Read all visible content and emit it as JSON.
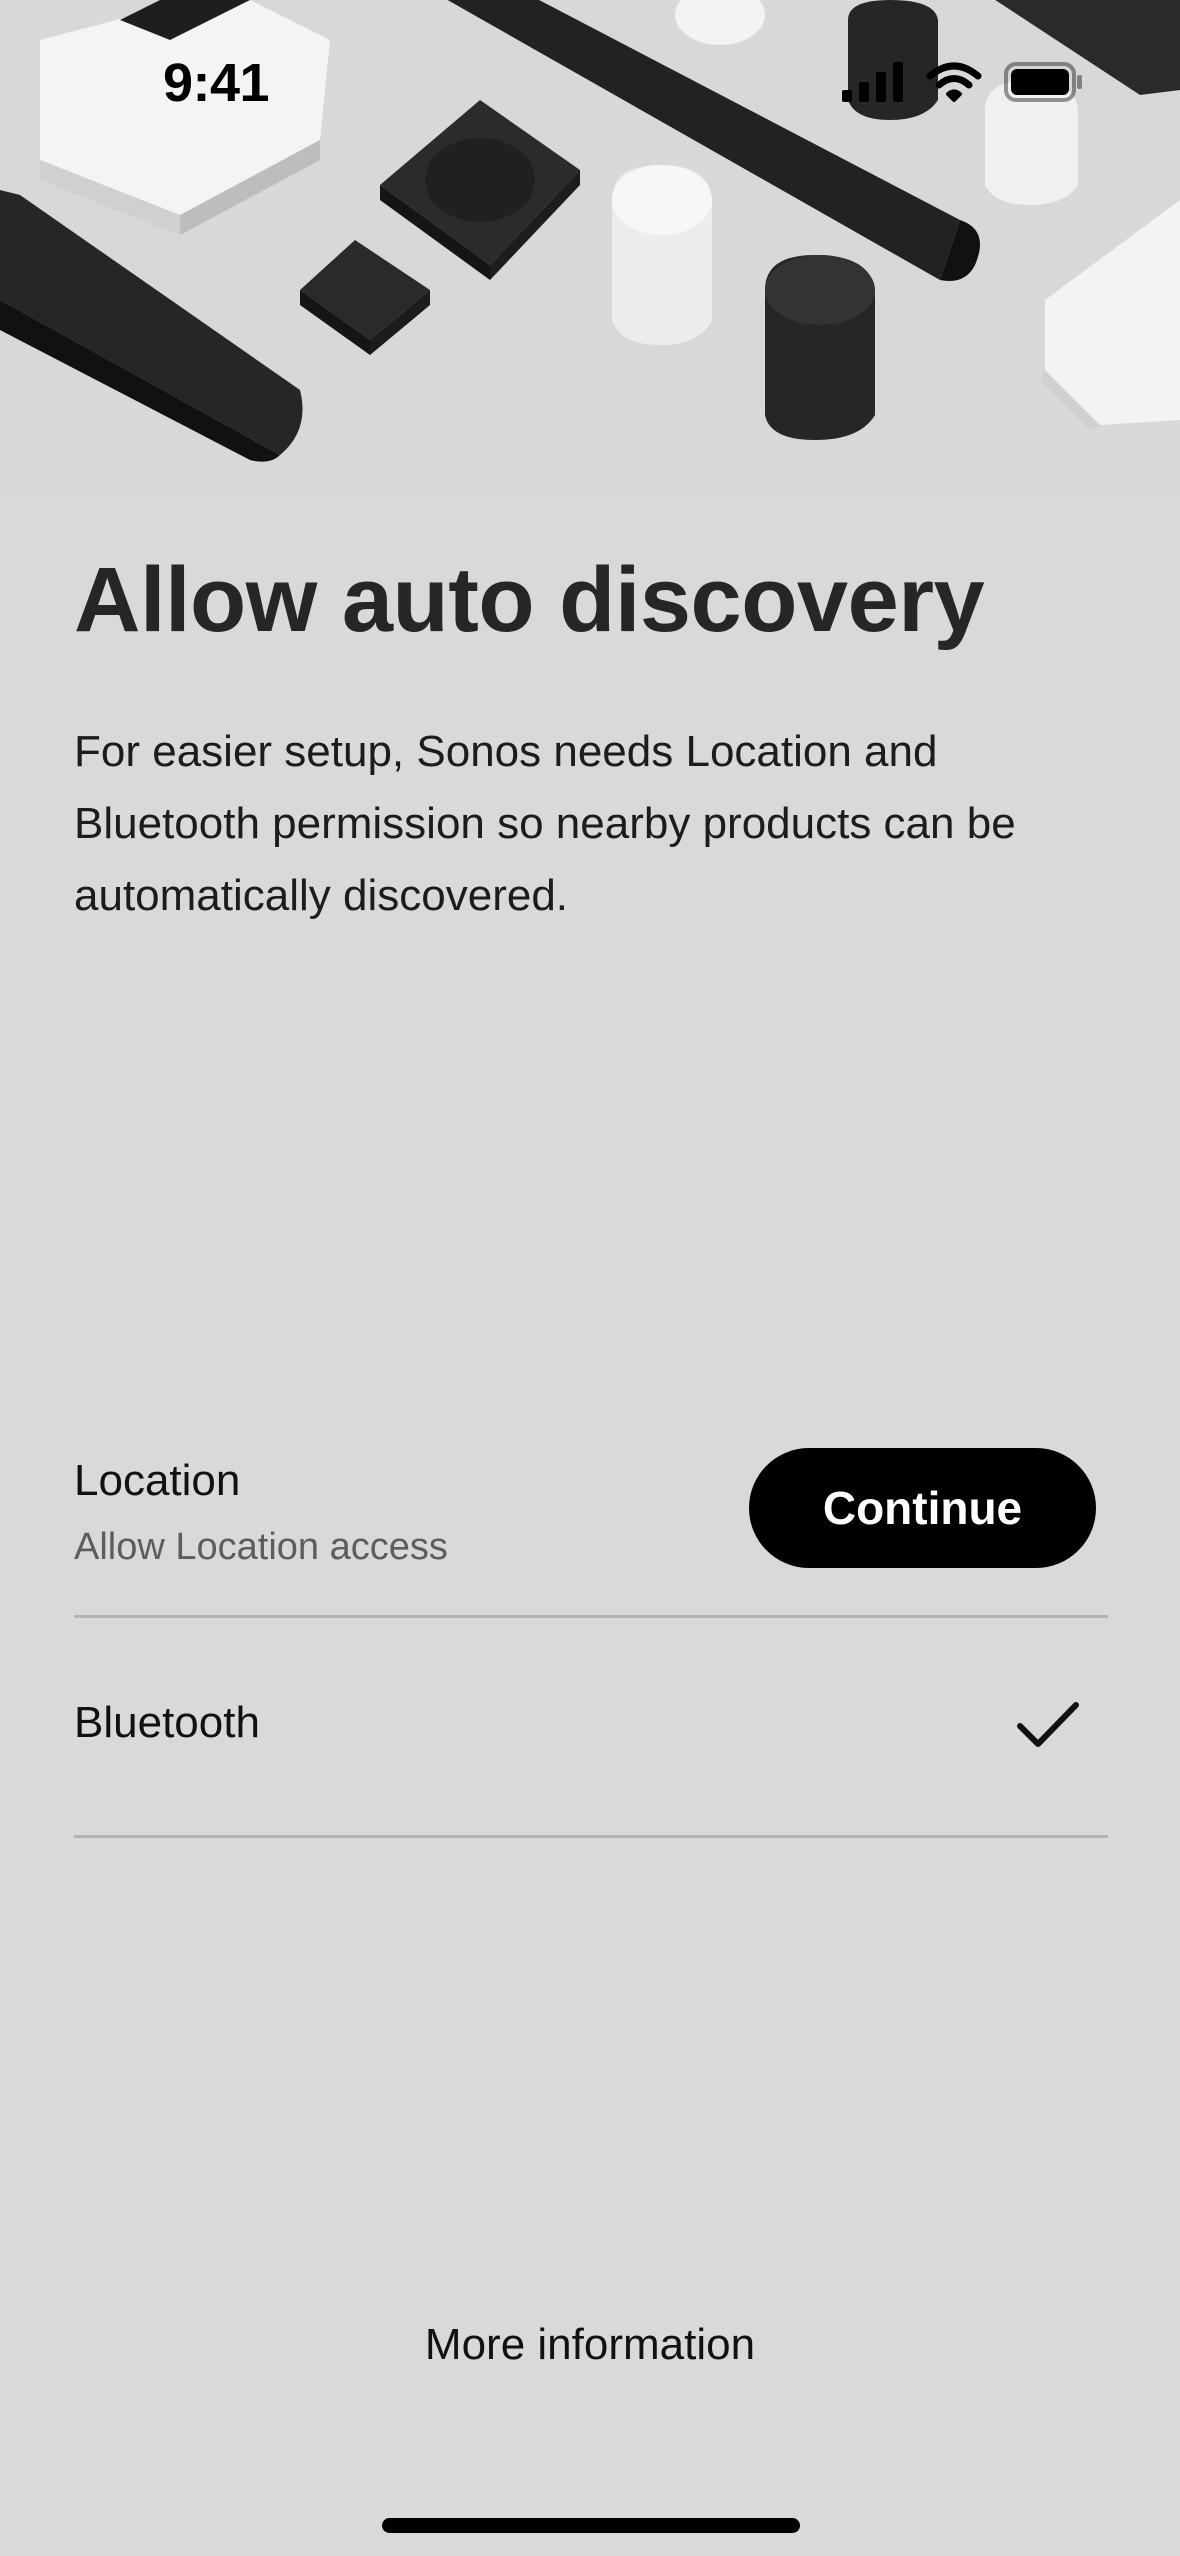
{
  "status_bar": {
    "time": "9:41",
    "icons": [
      "cellular-signal-icon",
      "wifi-icon",
      "battery-icon"
    ]
  },
  "hero": {
    "illustration": "sonos-products-illustration"
  },
  "content": {
    "title": "Allow auto discovery",
    "description": "For easier setup, Sonos needs Location and Bluetooth permission so nearby products can be automatically discovered."
  },
  "permissions": {
    "location": {
      "title": "Location",
      "subtitle": "Allow Location access",
      "action_label": "Continue"
    },
    "bluetooth": {
      "title": "Bluetooth",
      "status_icon": "checkmark-icon"
    }
  },
  "footer": {
    "more_info_label": "More information"
  },
  "colors": {
    "background": "#d9d9d9",
    "button": "#000000",
    "button_text": "#ffffff",
    "divider": "#b3b3b3",
    "subtitle": "#5d5d5d"
  }
}
